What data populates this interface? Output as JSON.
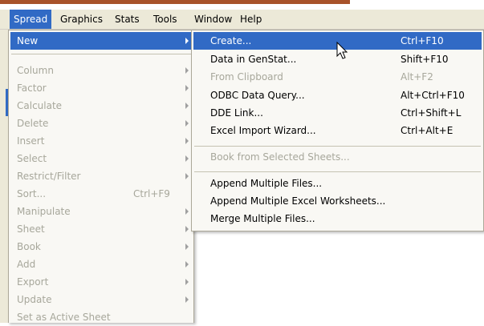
{
  "menubar": {
    "items": [
      "Spread",
      "Graphics",
      "Stats",
      "Tools",
      "Window",
      "Help"
    ],
    "active": "Spread"
  },
  "spread_menu": {
    "items": [
      {
        "label": "New",
        "shortcut": "",
        "submenu": true,
        "disabled": false,
        "highlighted": true
      },
      {
        "label": "Column",
        "shortcut": "",
        "submenu": true,
        "disabled": true
      },
      {
        "label": "Factor",
        "shortcut": "",
        "submenu": true,
        "disabled": true
      },
      {
        "label": "Calculate",
        "shortcut": "",
        "submenu": true,
        "disabled": true
      },
      {
        "label": "Delete",
        "shortcut": "",
        "submenu": true,
        "disabled": true
      },
      {
        "label": "Insert",
        "shortcut": "",
        "submenu": true,
        "disabled": true
      },
      {
        "label": "Select",
        "shortcut": "",
        "submenu": true,
        "disabled": true
      },
      {
        "label": "Restrict/Filter",
        "shortcut": "",
        "submenu": true,
        "disabled": true
      },
      {
        "label": "Sort...",
        "shortcut": "Ctrl+F9",
        "submenu": false,
        "disabled": true
      },
      {
        "label": "Manipulate",
        "shortcut": "",
        "submenu": true,
        "disabled": true
      },
      {
        "label": "Sheet",
        "shortcut": "",
        "submenu": true,
        "disabled": true
      },
      {
        "label": "Book",
        "shortcut": "",
        "submenu": true,
        "disabled": true
      },
      {
        "label": "Add",
        "shortcut": "",
        "submenu": true,
        "disabled": true
      },
      {
        "label": "Export",
        "shortcut": "",
        "submenu": true,
        "disabled": true
      },
      {
        "label": "Update",
        "shortcut": "",
        "submenu": true,
        "disabled": true
      },
      {
        "label": "Set as Active Sheet",
        "shortcut": "",
        "submenu": false,
        "disabled": true
      }
    ]
  },
  "new_submenu": {
    "items": [
      {
        "label": "Create...",
        "shortcut": "Ctrl+F10",
        "disabled": false,
        "highlighted": true
      },
      {
        "label": "Data in GenStat...",
        "shortcut": "Shift+F10",
        "disabled": false
      },
      {
        "label": "From Clipboard",
        "shortcut": "Alt+F2",
        "disabled": true
      },
      {
        "label": "ODBC Data Query...",
        "shortcut": "Alt+Ctrl+F10",
        "disabled": false
      },
      {
        "label": "DDE Link...",
        "shortcut": "Ctrl+Shift+L",
        "disabled": false
      },
      {
        "label": "Excel Import Wizard...",
        "shortcut": "Ctrl+Alt+E",
        "disabled": false
      },
      {
        "label": "Book from Selected Sheets...",
        "shortcut": "",
        "disabled": true
      },
      {
        "label": "Append Multiple Files...",
        "shortcut": "",
        "disabled": false
      },
      {
        "label": "Append Multiple Excel Worksheets...",
        "shortcut": "",
        "disabled": false
      },
      {
        "label": "Merge Multiple Files...",
        "shortcut": "",
        "disabled": false
      }
    ]
  },
  "colors": {
    "highlight": "#316ac5",
    "menu_bg": "#f9f8f4",
    "menubar_bg": "#ece9d8",
    "disabled_text": "#a7a79b",
    "title_strip": "#a8532a"
  },
  "icons": {
    "cursor": "mouse-pointer-icon",
    "submenu_arrow": "submenu-arrow-icon"
  }
}
